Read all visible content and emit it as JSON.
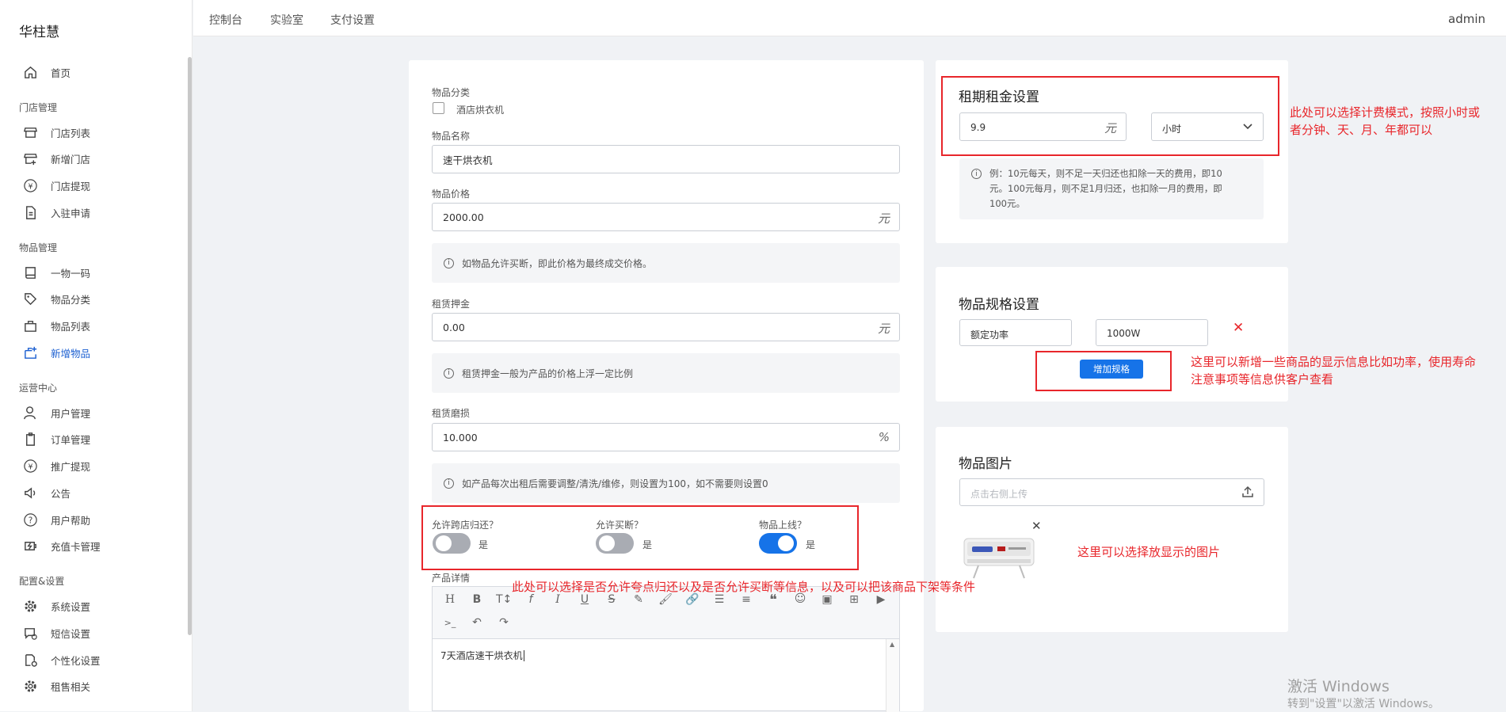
{
  "app": {
    "title": "华柱慧",
    "user": "admin"
  },
  "topnav": [
    "控制台",
    "实验室",
    "支付设置"
  ],
  "sidebar": {
    "home": "首页",
    "g1": "门店管理",
    "store_list": "门店列表",
    "add_store": "新增门店",
    "store_withdraw": "门店提现",
    "apply": "入驻申请",
    "g2": "物品管理",
    "one_code": "一物一码",
    "category": "物品分类",
    "item_list": "物品列表",
    "add_item": "新增物品",
    "g3": "运营中心",
    "users": "用户管理",
    "orders": "订单管理",
    "promo": "推广提现",
    "notice": "公告",
    "help": "用户帮助",
    "recharge": "充值卡管理",
    "g4": "配置&设置",
    "sys": "系统设置",
    "sms": "短信设置",
    "custom": "个性化设置",
    "rent": "租售相关"
  },
  "form": {
    "category_label": "物品分类",
    "category_option": "酒店烘衣机",
    "name_label": "物品名称",
    "name_value": "速干烘衣机",
    "price_label": "物品价格",
    "price_value": "2000.00",
    "price_unit": "元",
    "price_tip": "如物品允许买断，即此价格为最终成交价格。",
    "deposit_label": "租赁押金",
    "deposit_value": "0.00",
    "deposit_unit": "元",
    "deposit_tip": "租赁押金一般为产品的价格上浮一定比例",
    "wear_label": "租赁磨损",
    "wear_value": "10.000",
    "wear_unit": "%",
    "wear_tip": "如产品每次出租后需要调整/清洗/维修，则设置为100，如不需要则设置0",
    "cross_return": "允许跨店归还？",
    "buyout": "允许买断？",
    "online": "物品上线？",
    "yes": "是",
    "detail_label": "产品详情",
    "detail_text": "7天酒店速干烘衣机",
    "toggles": {
      "cross_return": false,
      "buyout": false,
      "online": true
    }
  },
  "rent": {
    "title": "租期租金设置",
    "value": "9.9",
    "unit": "元",
    "period": "小时",
    "tip": [
      "例：10元每天，则不足一天归还也扣除一天的费用，即10",
      "元。100元每月，则不足1月归还，也扣除一月的费用，即",
      "100元。"
    ]
  },
  "spec": {
    "title": "物品规格设置",
    "key": "额定功率",
    "value": "1000W",
    "add_button": "增加规格"
  },
  "image": {
    "title": "物品图片",
    "placeholder": "点击右侧上传"
  },
  "notes": {
    "rent": [
      "此处可以选择计费模式，按照小时或",
      "者分钟、天、月、年都可以"
    ],
    "spec": [
      "这里可以新增一些商品的显示信息比如功率，使用寿命",
      "注意事项等信息供客户查看"
    ],
    "image": "这里可以选择放显示的图片",
    "toggles": "此处可以选择是否允许夸点归还以及是否允许买断等信息，以及可以把该商品下架等条件"
  },
  "watermark": {
    "line1": "激活 Windows",
    "line2": "转到\"设置\"以激活 Windows。"
  },
  "colors": {
    "accent": "#1673e8",
    "annotation": "#e8262b"
  }
}
